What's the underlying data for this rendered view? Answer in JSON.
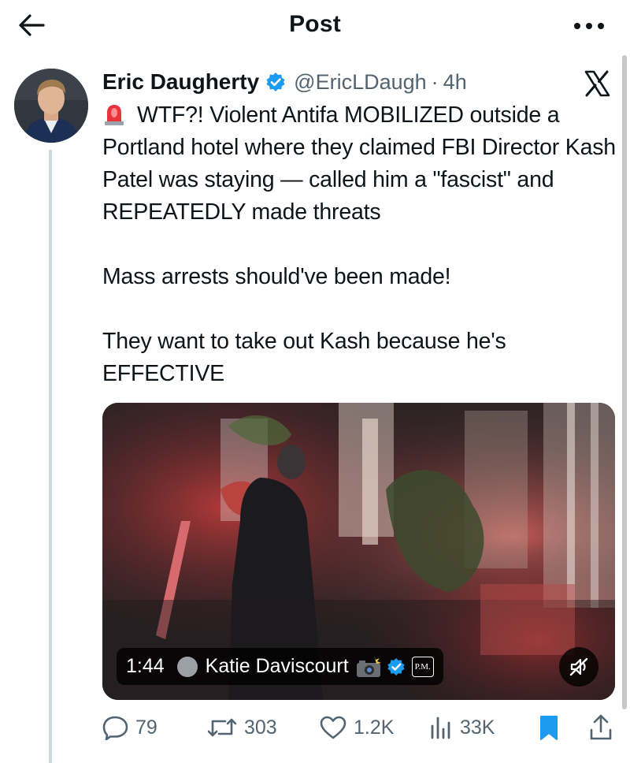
{
  "header": {
    "title": "Post"
  },
  "post": {
    "author": {
      "display_name": "Eric Daugherty",
      "handle": "@EricLDaugh",
      "separator": "·",
      "time": "4h"
    },
    "text": "WTF?! Violent Antifa MOBILIZED outside a Portland hotel where they claimed FBI Director Kash Patel was staying — called him a \"fascist\" and REPEATEDLY made threats\n\nMass arrests should've been made!\n\nThey want to take out Kash because he's EFFECTIVE",
    "media": {
      "duration": "1:44",
      "source_name": "Katie Daviscourt",
      "badge_text": "P.M."
    },
    "metrics": {
      "replies": "79",
      "reposts": "303",
      "likes": "1.2K",
      "views": "33K"
    }
  },
  "icons": {
    "back": "arrow-left-icon",
    "more": "more-horizontal-icon",
    "verified": "verified-badge-icon",
    "platform": "x-logo-icon",
    "siren": "police-siren-emoji",
    "reply": "reply-icon",
    "repost": "repost-icon",
    "like": "heart-icon",
    "views": "views-chart-icon",
    "bookmark": "bookmark-filled-icon",
    "share": "share-icon",
    "mute": "speaker-muted-icon"
  },
  "colors": {
    "accent": "#1d9bf0",
    "text_primary": "#0f1419",
    "text_secondary": "#536471",
    "thread_line": "#cfd9de"
  }
}
